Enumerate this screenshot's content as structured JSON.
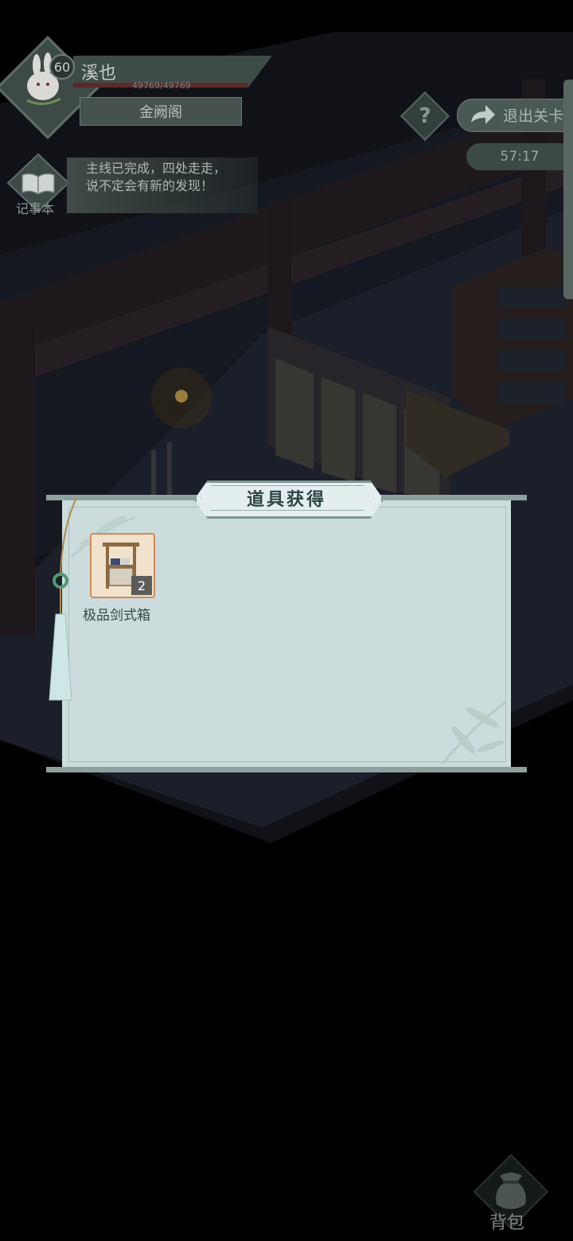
{
  "player": {
    "level": "60",
    "name": "溪也",
    "hp_text": "49769/49769",
    "location": "金阙阁"
  },
  "quest": {
    "icon_label": "记事本",
    "text": "主线已完成，四处走走，说不定会有新的发现！"
  },
  "top_right": {
    "help_glyph": "?",
    "exit_label": "退出关卡",
    "timer": "57:17"
  },
  "dialog": {
    "title": "道具获得",
    "items": [
      {
        "name": "极品剑式箱",
        "count": "2",
        "icon": "weapon-rack-crate-icon"
      }
    ]
  },
  "bottom": {
    "bag_label": "背包",
    "bag_icon": "pouch-icon"
  },
  "colors": {
    "dialog_bg": "#ccdcdc",
    "dialog_rod": "#8ea1a1",
    "item_border": "#d08a55"
  }
}
